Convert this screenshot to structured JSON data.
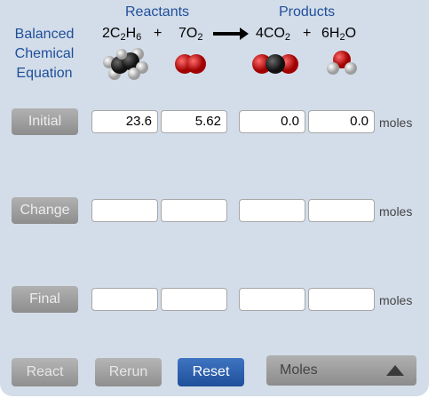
{
  "headers": {
    "reactants": "Reactants",
    "products": "Products"
  },
  "equation": {
    "label": "Balanced Chemical Equation",
    "plus": "+",
    "reactant1": {
      "coef": "2",
      "formula": [
        "C",
        "2",
        "H",
        "6"
      ]
    },
    "reactant2": {
      "coef": "7",
      "formula": [
        "O",
        "2"
      ]
    },
    "product1": {
      "coef": "4",
      "formula": [
        "CO",
        "2"
      ]
    },
    "product2": {
      "coef": "6",
      "formula": [
        "H",
        "2",
        "O"
      ]
    }
  },
  "molecule_icons": [
    "ethane-molecule-icon",
    "oxygen-molecule-icon",
    "carbon-dioxide-molecule-icon",
    "water-molecule-icon"
  ],
  "rows": {
    "initial": {
      "label": "Initial",
      "values": [
        "23.6",
        "5.62",
        "0.0",
        "0.0"
      ],
      "unit": "moles"
    },
    "change": {
      "label": "Change",
      "values": [
        "",
        "",
        "",
        ""
      ],
      "unit": "moles"
    },
    "final": {
      "label": "Final",
      "values": [
        "",
        "",
        "",
        ""
      ],
      "unit": "moles"
    }
  },
  "buttons": {
    "react": "React",
    "rerun": "Rerun",
    "reset": "Reset"
  },
  "units_dropdown": {
    "selected": "Moles"
  },
  "colors": {
    "panel": "#d3dde9",
    "heading_blue": "#1f4f9a",
    "reset_blue": "#2a5ca8",
    "button_gray": "#a0a0a0"
  }
}
